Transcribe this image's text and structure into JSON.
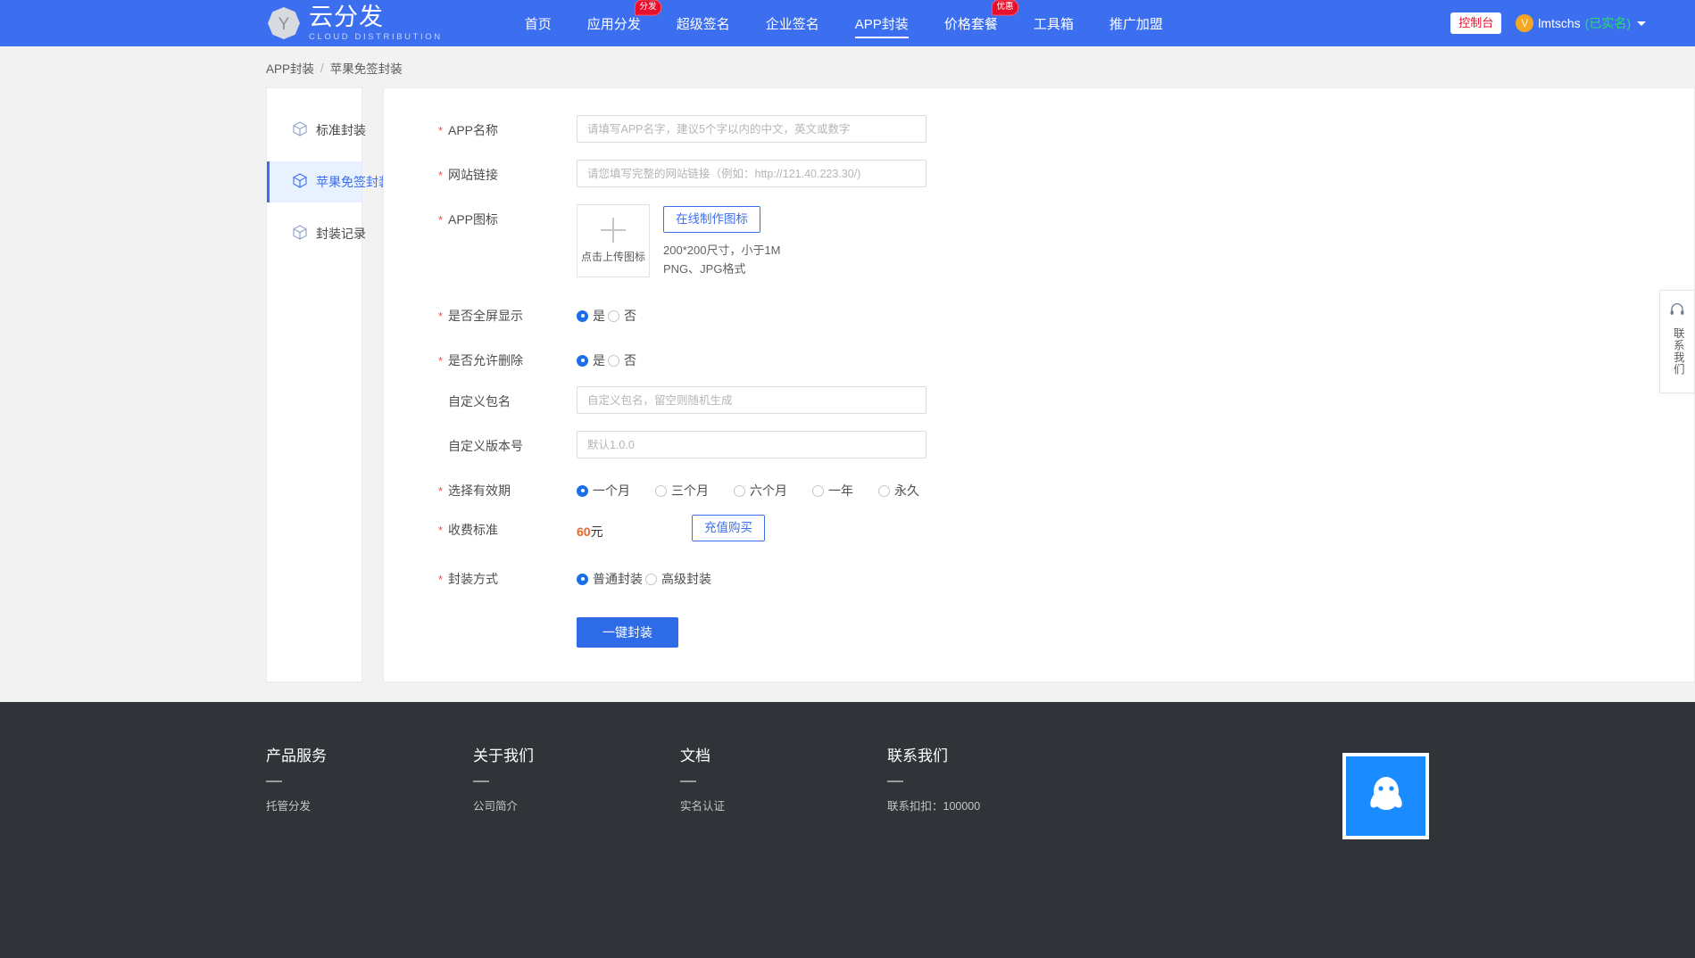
{
  "header": {
    "logo": {
      "title": "云分发",
      "subtitle": "CLOUD DISTRIBUTION",
      "mark_letter": "Y"
    },
    "nav": [
      {
        "label": "首页",
        "active": false,
        "badge": ""
      },
      {
        "label": "应用分发",
        "active": false,
        "badge": "分发"
      },
      {
        "label": "超级签名",
        "active": false,
        "badge": ""
      },
      {
        "label": "企业签名",
        "active": false,
        "badge": ""
      },
      {
        "label": "APP封装",
        "active": true,
        "badge": ""
      },
      {
        "label": "价格套餐",
        "active": false,
        "badge": "优惠"
      },
      {
        "label": "工具箱",
        "active": false,
        "badge": ""
      },
      {
        "label": "推广加盟",
        "active": false,
        "badge": ""
      }
    ],
    "console_label": "控制台",
    "user": {
      "avatar_letter": "V",
      "name": "lmtschs",
      "verified": "(已实名)"
    },
    "brand_color": "#3c6ef0",
    "badge_color": "#e8112d"
  },
  "breadcrumb": {
    "root": "APP封装",
    "separator": "/",
    "current": "苹果免签封装"
  },
  "sidebar": {
    "items": [
      {
        "label": "标准封装",
        "icon": "cube-icon",
        "active": false
      },
      {
        "label": "苹果免签封装",
        "icon": "cube-icon",
        "active": true
      },
      {
        "label": "封装记录",
        "icon": "cube-icon",
        "active": false
      }
    ],
    "active_color": "#3c6ef0"
  },
  "form": {
    "app_name": {
      "label": "APP名称",
      "required": true,
      "value": "",
      "placeholder": "请填写APP名字，建议5个字以内的中文，英文或数字"
    },
    "site_url": {
      "label": "网站链接",
      "required": true,
      "value": "",
      "placeholder": "请您填写完整的网站链接（例如：http://121.40.223.30/)"
    },
    "app_icon": {
      "label": "APP图标",
      "required": true,
      "upload_label": "点击上传图标",
      "make_icon_button": "在线制作图标",
      "hint_line1": "200*200尺寸，小于1M",
      "hint_line2": "PNG、JPG格式"
    },
    "fullscreen": {
      "label": "是否全屏显示",
      "required": true,
      "options": [
        {
          "label": "是",
          "selected": true
        },
        {
          "label": "否",
          "selected": false
        }
      ]
    },
    "allow_delete": {
      "label": "是否允许删除",
      "required": true,
      "options": [
        {
          "label": "是",
          "selected": true
        },
        {
          "label": "否",
          "selected": false
        }
      ]
    },
    "package_name": {
      "label": "自定义包名",
      "required": false,
      "value": "",
      "placeholder": "自定义包名，留空则随机生成"
    },
    "version": {
      "label": "自定义版本号",
      "required": false,
      "value": "",
      "placeholder": "默认1.0.0"
    },
    "validity": {
      "label": "选择有效期",
      "required": true,
      "options": [
        {
          "label": "一个月",
          "selected": true
        },
        {
          "label": "三个月",
          "selected": false
        },
        {
          "label": "六个月",
          "selected": false
        },
        {
          "label": "一年",
          "selected": false
        },
        {
          "label": "永久",
          "selected": false
        }
      ]
    },
    "fee": {
      "label": "收费标准",
      "required": true,
      "amount": "60",
      "unit": "元",
      "buy_button": "充值购买",
      "amount_color": "#f26522"
    },
    "pack_mode": {
      "label": "封装方式",
      "required": true,
      "options": [
        {
          "label": "普通封装",
          "selected": true
        },
        {
          "label": "高级封装",
          "selected": false
        }
      ]
    },
    "submit_label": "一键封装",
    "required_mark": "*"
  },
  "float_contact": {
    "icon": "headset-icon",
    "text": "联系我们"
  },
  "footer": {
    "columns": [
      {
        "title": "产品服务",
        "links": [
          "托管分发"
        ]
      },
      {
        "title": "关于我们",
        "links": [
          "公司简介"
        ]
      },
      {
        "title": "文档",
        "links": [
          "实名认证"
        ]
      },
      {
        "title": "联系我们",
        "links": [
          "联系扣扣：100000"
        ]
      }
    ],
    "qr_icon": "qq-icon",
    "background": "#303338"
  }
}
